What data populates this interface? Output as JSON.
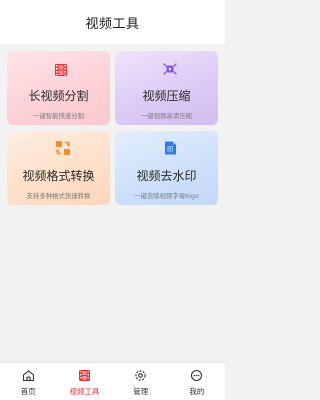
{
  "header": {
    "title": "视频工具"
  },
  "colors": {
    "accent": "#e0303a",
    "background": "#f2f2f2"
  },
  "tools": [
    {
      "title": "长视频分割",
      "subtitle": "一键智能快速分割",
      "icon": "film-icon"
    },
    {
      "title": "视频压缩",
      "subtitle": "一键视频高清压缩",
      "icon": "compress-video-icon"
    },
    {
      "title": "视频格式转换",
      "subtitle": "支持多种格式快速转换",
      "icon": "convert-icon"
    },
    {
      "title": "视频去水印",
      "subtitle": "一键去除视频字母logo",
      "icon": "stamp-icon"
    }
  ],
  "tabbar": {
    "items": [
      {
        "label": "首页",
        "icon": "home-icon",
        "active": false
      },
      {
        "label": "视频工具",
        "icon": "film-icon",
        "active": true
      },
      {
        "label": "管理",
        "icon": "settings-icon",
        "active": false
      },
      {
        "label": "我的",
        "icon": "chat-smile-icon",
        "active": false
      }
    ]
  }
}
